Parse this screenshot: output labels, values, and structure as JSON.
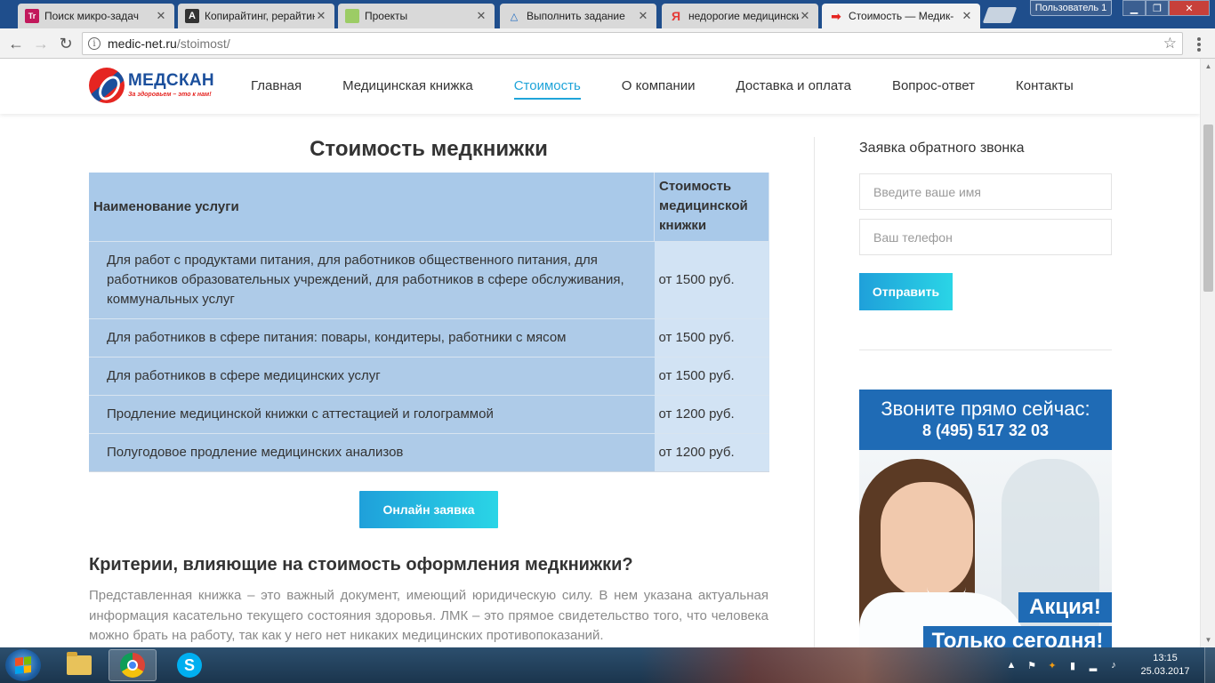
{
  "browser": {
    "tabs": [
      {
        "title": "Поиск микро-задач",
        "favicon": "Tr",
        "favicon_color": "#c2185b"
      },
      {
        "title": "Копирайтинг, рерайтинг",
        "favicon": "A",
        "favicon_color": "#333333"
      },
      {
        "title": "Проекты",
        "favicon": "",
        "favicon_color": "#9ccc65"
      },
      {
        "title": "Выполнить задание",
        "favicon": "△",
        "favicon_color": "#1565c0"
      },
      {
        "title": "недорогие медицинские",
        "favicon": "Я",
        "favicon_color": "#e53935"
      },
      {
        "title": "Стоимость — Медик-",
        "favicon": "➡",
        "favicon_color": "#e52521"
      }
    ],
    "user_label": "Пользователь 1",
    "url_host": "medic-net.ru",
    "url_path": "/stoimost/",
    "info_icon": "i",
    "star_icon": "☆",
    "back_icon": "←",
    "forward_icon": "→",
    "reload_icon": "↻"
  },
  "site": {
    "logo": {
      "name": "МЕДСКАН",
      "tagline": "За здоровьем – это к нам!"
    },
    "nav": [
      {
        "label": "Главная",
        "active": false
      },
      {
        "label": "Медицинская книжка",
        "active": false
      },
      {
        "label": "Стоимость",
        "active": true
      },
      {
        "label": "О компании",
        "active": false
      },
      {
        "label": "Доставка и оплата",
        "active": false
      },
      {
        "label": "Вопрос-ответ",
        "active": false
      },
      {
        "label": "Контакты",
        "active": false
      }
    ],
    "accent_color": "#1fa4d9"
  },
  "main": {
    "title": "Стоимость медкнижки",
    "table": {
      "headers": [
        "Наименование услуги",
        "Стоимость медицинской книжки"
      ],
      "rows": [
        {
          "service": "Для работ с продуктами питания, для работников общественного питания, для работников образовательных учреждений, для работников в сфере обслуживания, коммунальных услуг",
          "price": "от 1500 руб."
        },
        {
          "service": "Для работников в сфере питания: повары, кондитеры, работники с мясом",
          "price": "от 1500 руб."
        },
        {
          "service": "Для работников в сфере медицинских услуг",
          "price": "от 1500 руб."
        },
        {
          "service": "Продление медицинской книжки с аттестацией и голограммой",
          "price": "от 1200 руб."
        },
        {
          "service": "Полугодовое продление медицинских анализов",
          "price": "от 1200 руб."
        }
      ]
    },
    "cta_label": "Онлайн заявка",
    "section_heading": "Критерии, влияющие на стоимость оформления медкнижки?",
    "section_text": "Представленная книжка – это важный документ, имеющий юридическую силу. В нем указана актуальная информация касательно текущего состояния здоровья. ЛМК – это прямое свидетельство того, что человека можно брать на работу, так как у него нет никаких медицинских противопоказаний."
  },
  "sidebar": {
    "title": "Заявка обратного звонка",
    "name_placeholder": "Введите ваше имя",
    "phone_placeholder": "Ваш телефон",
    "submit_label": "Отправить",
    "banner": {
      "call_text": "Звоните прямо сейчас:",
      "phone": "8 (495) 517 32 03",
      "promo_1": "Акция!",
      "promo_2": "Только сегодня!"
    }
  },
  "taskbar": {
    "time": "13:15",
    "date": "25.03.2017",
    "apps": [
      "explorer",
      "chrome",
      "skype"
    ]
  }
}
